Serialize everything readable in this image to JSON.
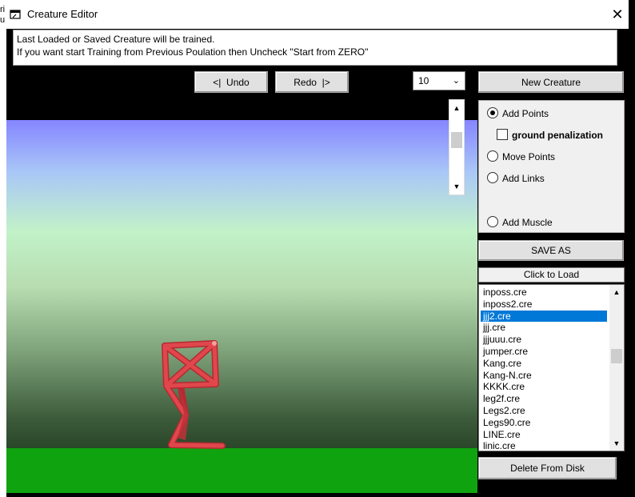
{
  "background": {
    "left_text": "ri\nu"
  },
  "window": {
    "title": "Creature Editor",
    "close_glyph": "✕"
  },
  "info": {
    "line1": "Last Loaded or Saved Creature will be trained.",
    "line2": "If you want start Training from Previous Poulation then Uncheck \"Start from ZERO\""
  },
  "toolbar": {
    "undo_label": "<|  Undo",
    "redo_label": "Redo  |>",
    "generations_value": "10",
    "new_creature_label": "New Creature"
  },
  "tools": {
    "add_points": "Add Points",
    "ground_penalization": "ground penalization",
    "move_points": "Move Points",
    "add_links": "Add Links",
    "add_muscle": "Add Muscle",
    "selected": "Add Points"
  },
  "save_as_label": "SAVE AS",
  "load": {
    "header": "Click to Load",
    "files": [
      "inposs.cre",
      "inposs2.cre",
      "jjj2.cre",
      "jjj.cre",
      "jjjuuu.cre",
      "jumper.cre",
      "Kang.cre",
      "Kang-N.cre",
      "KKKK.cre",
      "leg2f.cre",
      "Legs2.cre",
      "Legs90.cre",
      "LINE.cre",
      "linic.cre"
    ],
    "selected_index": 2
  },
  "delete_label": "Delete From Disk",
  "colors": {
    "sky_top": "#8585ff",
    "ground": "#10a310",
    "creature": "#e0474c",
    "selection": "#0078d7"
  }
}
